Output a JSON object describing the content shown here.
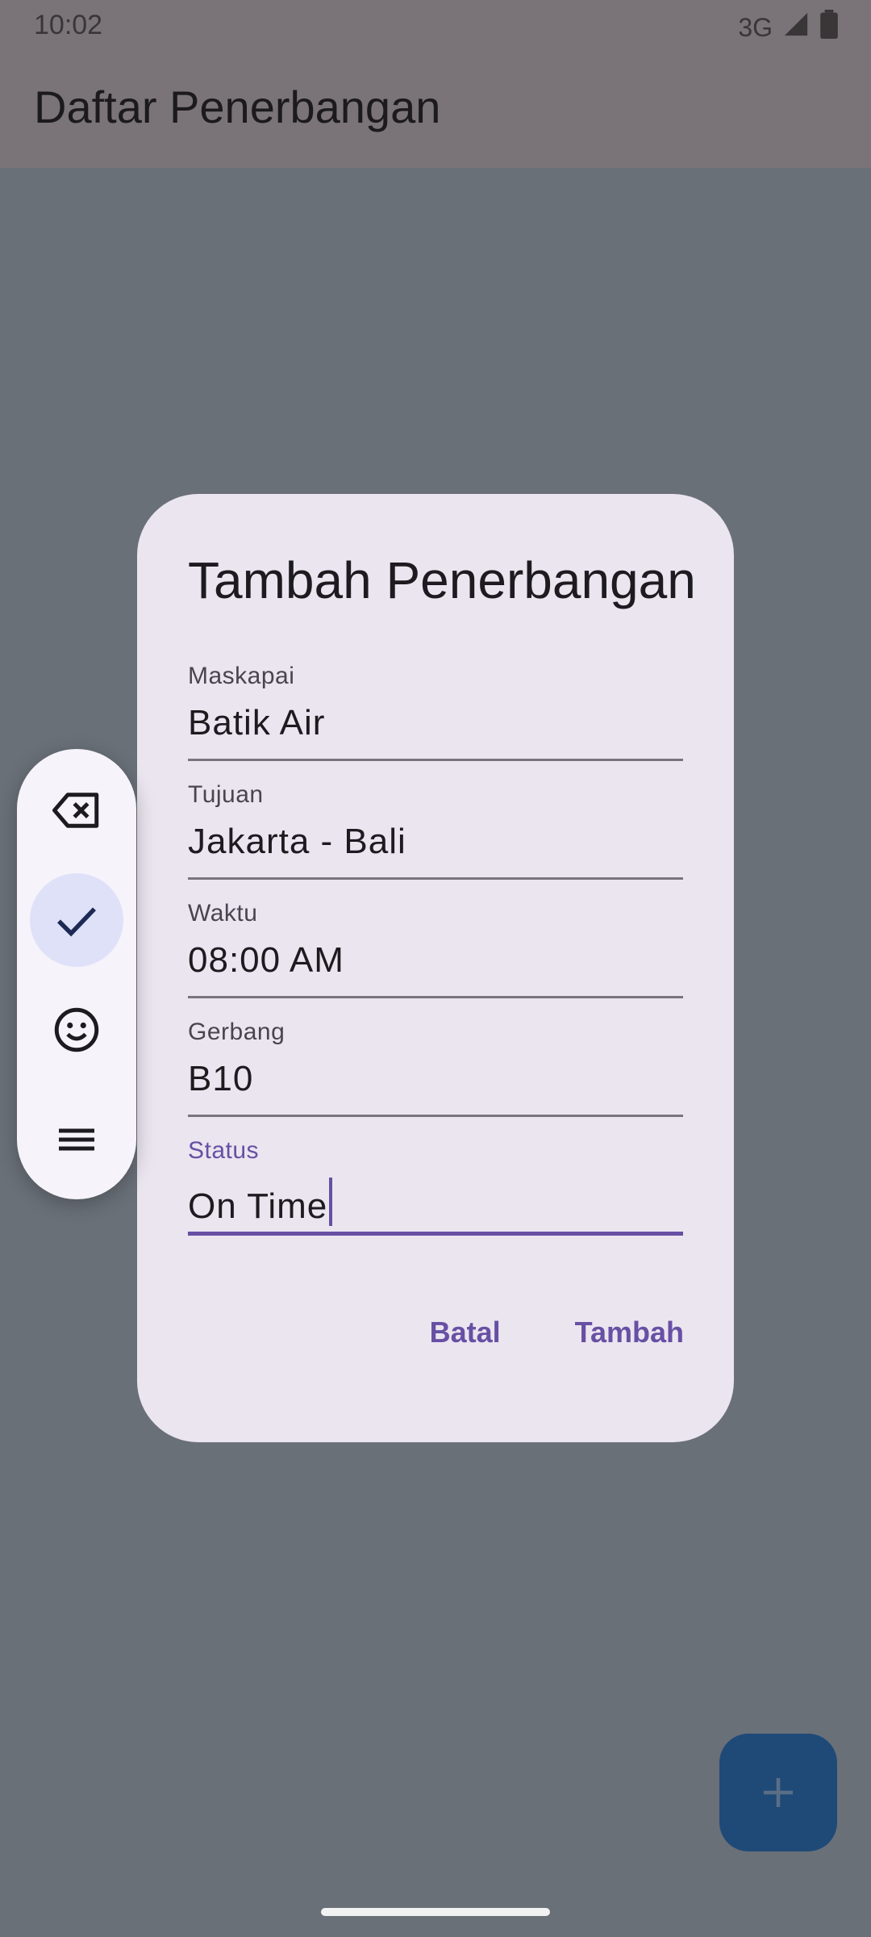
{
  "status_bar": {
    "time": "10:02",
    "network": "3G",
    "icons": [
      "signal-icon",
      "battery-icon"
    ]
  },
  "app_bar": {
    "title": "Daftar Penerbangan"
  },
  "dialog": {
    "title": "Tambah Penerbangan",
    "fields": [
      {
        "label": "Maskapai",
        "value": "Batik Air"
      },
      {
        "label": "Tujuan",
        "value": "Jakarta - Bali"
      },
      {
        "label": "Waktu",
        "value": "08:00 AM"
      },
      {
        "label": "Gerbang",
        "value": "B10"
      },
      {
        "label": "Status",
        "value": "On Time",
        "focused": true
      }
    ],
    "cancel_label": "Batal",
    "confirm_label": "Tambah"
  },
  "keyboard_toolbar": {
    "items": [
      "backspace-icon",
      "check-icon",
      "emoji-icon",
      "menu-icon"
    ],
    "active": "check-icon"
  },
  "fab": {
    "icon": "add-icon"
  },
  "colors": {
    "accent": "#6750a4",
    "fab": "#1f4a78",
    "dialog_bg": "#ebe5ef",
    "scrim": "#6a7078"
  }
}
